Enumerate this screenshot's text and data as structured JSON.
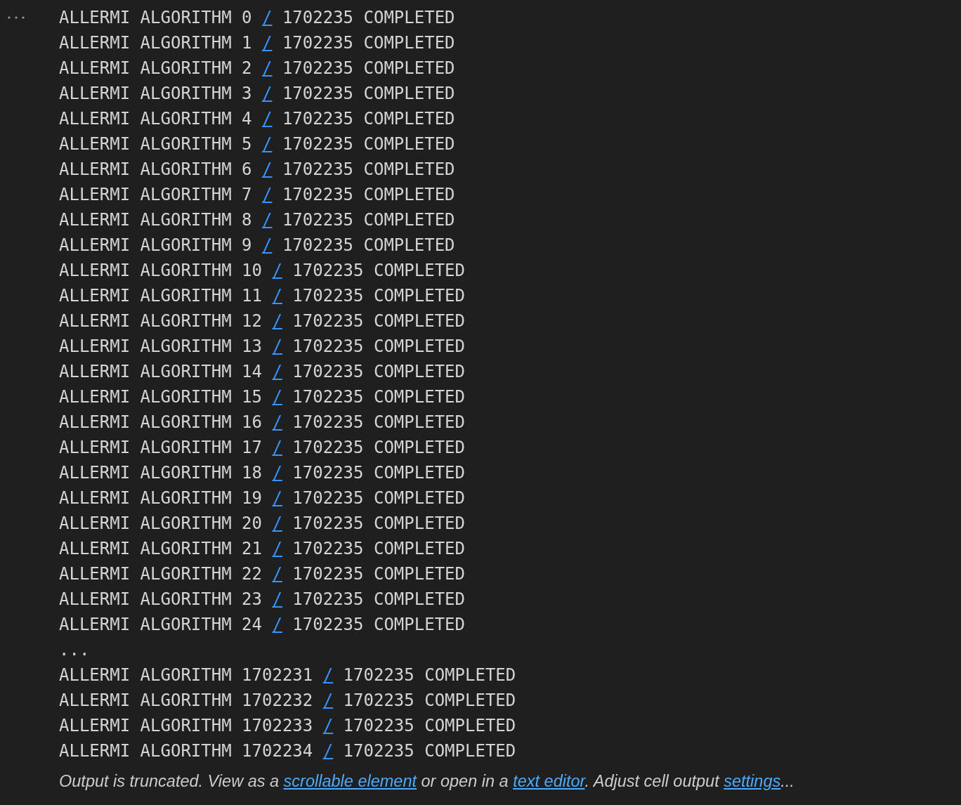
{
  "output": {
    "lines": [
      {
        "kind": "line",
        "before": "ALLERMI ALGORITHM 0",
        "link": "/",
        "after": "1702235 COMPLETED"
      },
      {
        "kind": "line",
        "before": "ALLERMI ALGORITHM 1",
        "link": "/",
        "after": "1702235 COMPLETED"
      },
      {
        "kind": "line",
        "before": "ALLERMI ALGORITHM 2",
        "link": "/",
        "after": "1702235 COMPLETED"
      },
      {
        "kind": "line",
        "before": "ALLERMI ALGORITHM 3",
        "link": "/",
        "after": "1702235 COMPLETED"
      },
      {
        "kind": "line",
        "before": "ALLERMI ALGORITHM 4",
        "link": "/",
        "after": "1702235 COMPLETED"
      },
      {
        "kind": "line",
        "before": "ALLERMI ALGORITHM 5",
        "link": "/",
        "after": "1702235 COMPLETED"
      },
      {
        "kind": "line",
        "before": "ALLERMI ALGORITHM 6",
        "link": "/",
        "after": "1702235 COMPLETED"
      },
      {
        "kind": "line",
        "before": "ALLERMI ALGORITHM 7",
        "link": "/",
        "after": "1702235 COMPLETED"
      },
      {
        "kind": "line",
        "before": "ALLERMI ALGORITHM 8",
        "link": "/",
        "after": "1702235 COMPLETED"
      },
      {
        "kind": "line",
        "before": "ALLERMI ALGORITHM 9",
        "link": "/",
        "after": "1702235 COMPLETED"
      },
      {
        "kind": "line",
        "before": "ALLERMI ALGORITHM 10",
        "link": "/",
        "after": "1702235 COMPLETED"
      },
      {
        "kind": "line",
        "before": "ALLERMI ALGORITHM 11",
        "link": "/",
        "after": "1702235 COMPLETED"
      },
      {
        "kind": "line",
        "before": "ALLERMI ALGORITHM 12",
        "link": "/",
        "after": "1702235 COMPLETED"
      },
      {
        "kind": "line",
        "before": "ALLERMI ALGORITHM 13",
        "link": "/",
        "after": "1702235 COMPLETED"
      },
      {
        "kind": "line",
        "before": "ALLERMI ALGORITHM 14",
        "link": "/",
        "after": "1702235 COMPLETED"
      },
      {
        "kind": "line",
        "before": "ALLERMI ALGORITHM 15",
        "link": "/",
        "after": "1702235 COMPLETED"
      },
      {
        "kind": "line",
        "before": "ALLERMI ALGORITHM 16",
        "link": "/",
        "after": "1702235 COMPLETED"
      },
      {
        "kind": "line",
        "before": "ALLERMI ALGORITHM 17",
        "link": "/",
        "after": "1702235 COMPLETED"
      },
      {
        "kind": "line",
        "before": "ALLERMI ALGORITHM 18",
        "link": "/",
        "after": "1702235 COMPLETED"
      },
      {
        "kind": "line",
        "before": "ALLERMI ALGORITHM 19",
        "link": "/",
        "after": "1702235 COMPLETED"
      },
      {
        "kind": "line",
        "before": "ALLERMI ALGORITHM 20",
        "link": "/",
        "after": "1702235 COMPLETED"
      },
      {
        "kind": "line",
        "before": "ALLERMI ALGORITHM 21",
        "link": "/",
        "after": "1702235 COMPLETED"
      },
      {
        "kind": "line",
        "before": "ALLERMI ALGORITHM 22",
        "link": "/",
        "after": "1702235 COMPLETED"
      },
      {
        "kind": "line",
        "before": "ALLERMI ALGORITHM 23",
        "link": "/",
        "after": "1702235 COMPLETED"
      },
      {
        "kind": "line",
        "before": "ALLERMI ALGORITHM 24",
        "link": "/",
        "after": "1702235 COMPLETED"
      },
      {
        "kind": "ellipsis",
        "text": "..."
      },
      {
        "kind": "line",
        "before": "ALLERMI ALGORITHM 1702231",
        "link": "/",
        "after": "1702235 COMPLETED"
      },
      {
        "kind": "line",
        "before": "ALLERMI ALGORITHM 1702232",
        "link": "/",
        "after": "1702235 COMPLETED"
      },
      {
        "kind": "line",
        "before": "ALLERMI ALGORITHM 1702233",
        "link": "/",
        "after": "1702235 COMPLETED"
      },
      {
        "kind": "line",
        "before": "ALLERMI ALGORITHM 1702234",
        "link": "/",
        "after": "1702235 COMPLETED"
      }
    ]
  },
  "truncation_notice": [
    {
      "kind": "text",
      "text": "Output is truncated. View as a "
    },
    {
      "kind": "link",
      "text": "scrollable element"
    },
    {
      "kind": "text",
      "text": " or open in a "
    },
    {
      "kind": "link",
      "text": "text editor"
    },
    {
      "kind": "text",
      "text": ". Adjust cell output "
    },
    {
      "kind": "link",
      "text": "settings"
    },
    {
      "kind": "text",
      "text": "..."
    }
  ]
}
